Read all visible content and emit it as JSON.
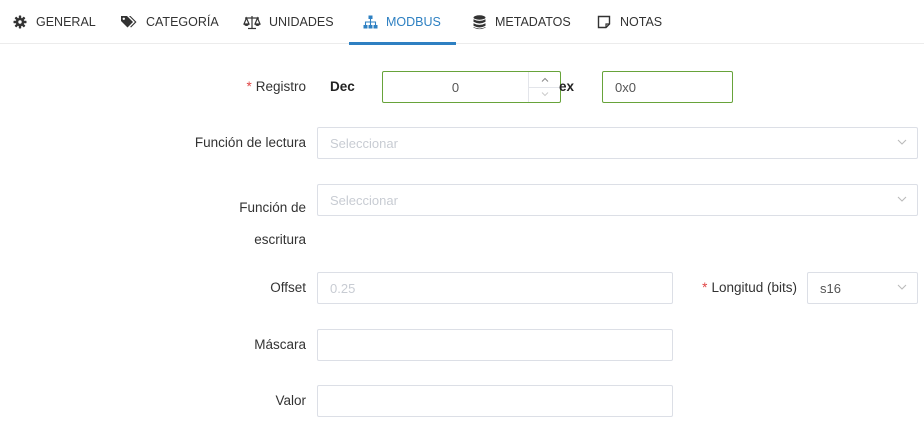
{
  "tabs": [
    {
      "label": "GENERAL",
      "icon": "gear-icon"
    },
    {
      "label": "CATEGORÍA",
      "icon": "tags-icon"
    },
    {
      "label": "UNIDADES",
      "icon": "balance-scale-icon"
    },
    {
      "label": "MODBUS",
      "icon": "sitemap-icon",
      "active": true
    },
    {
      "label": "METADATOS",
      "icon": "database-icon"
    },
    {
      "label": "NOTAS",
      "icon": "note-icon"
    }
  ],
  "form": {
    "registro": {
      "required_mark": "*",
      "label": "Registro",
      "dec_label": "Dec",
      "dec_value": "0",
      "hex_label": "ex",
      "hex_value": "0x0"
    },
    "funcion_lectura": {
      "label": "Función de lectura",
      "placeholder": "Seleccionar"
    },
    "funcion_escritura": {
      "label_line1": "Función de",
      "label_line2": "escritura",
      "placeholder": "Seleccionar"
    },
    "offset": {
      "label": "Offset",
      "placeholder": "0.25"
    },
    "longitud": {
      "required_mark": "*",
      "label": "Longitud (bits)",
      "value": "s16"
    },
    "mascara": {
      "label": "Máscara",
      "value": ""
    },
    "valor": {
      "label": "Valor",
      "value": ""
    }
  },
  "colors": {
    "accent": "#2e80c2",
    "valid_border": "#67a33a",
    "required": "#e04444"
  }
}
